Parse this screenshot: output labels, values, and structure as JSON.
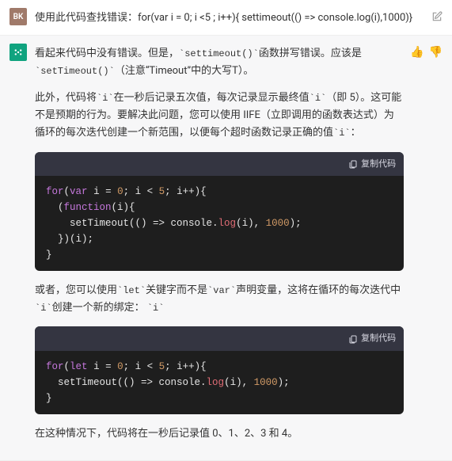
{
  "user": {
    "avatar": "BK",
    "text": "使用此代码查找错误：for(var i = 0; i <5 ; i++){ settimeout(() => console.log(i),1000)}"
  },
  "assistant": {
    "para1_a": "看起来代码中没有错误。但是，",
    "para1_code1": "`settimeout()`",
    "para1_b": "函数拼写错误。应该是",
    "para1_code2": "`setTimeout()`",
    "para1_c": "（注意“Timeout”中的大写T）。",
    "para2_a": "此外，代码将",
    "para2_code1": "`i`",
    "para2_b": "在一秒后记录五次值，每次记录显示最终值",
    "para2_code2": "`i`",
    "para2_c": "（即 5）。这可能不是预期的行为。要解决此问题，您可以使用 IIFE（立即调用的函数表达式）为循环的每次迭代创建一个新范围，以便每个超时函数记录正确的值",
    "para2_code3": "`i`",
    "para2_d": "：",
    "copy_label": "复制代码",
    "code1": {
      "kw_for": "for",
      "kw_var": "var",
      "var_i": "i",
      "eq": " = ",
      "zero": "0",
      "semi": "; ",
      "lt": " < ",
      "five": "5",
      "inc": "; i++){",
      "l2a": "  (",
      "kw_function": "function",
      "l2b": "(i){",
      "l3a": "    setTimeout(() => console.",
      "fn_log": "log",
      "l3b": "(i), ",
      "thousand": "1000",
      "l3c": ");",
      "l4": "  })(i);",
      "l5": "}"
    },
    "para3_a": "或者，您可以使用",
    "para3_code1": "`let`",
    "para3_b": "关键字而不是",
    "para3_code2": "`var`",
    "para3_c": "声明变量，这将在循环的每次迭代中",
    "para3_code3": "`i`",
    "para3_d": "创建一个新的绑定：",
    "para3_code4": "`i`",
    "code2": {
      "kw_for": "for",
      "kw_let": "let",
      "var_i": "i",
      "eq": " = ",
      "zero": "0",
      "semi": "; ",
      "lt": " < ",
      "five": "5",
      "inc": "; i++){",
      "l2a": "  setTimeout(() => console.",
      "fn_log": "log",
      "l2b": "(i), ",
      "thousand": "1000",
      "l2c": ");",
      "l3": "}"
    },
    "para4": "在这种情况下，代码将在一秒后记录值 0、1、2、3 和 4。"
  }
}
